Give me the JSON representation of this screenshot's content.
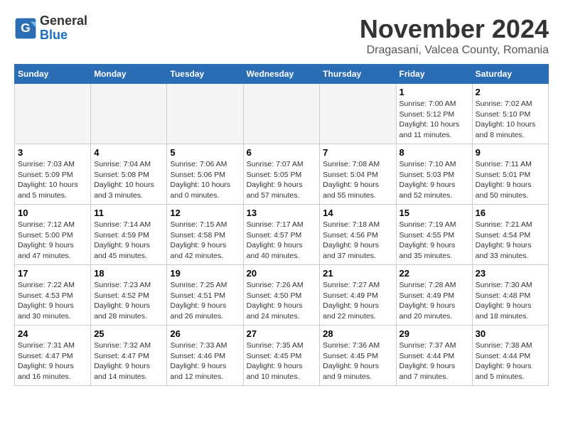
{
  "header": {
    "logo": {
      "general": "General",
      "blue": "Blue"
    },
    "title": "November 2024",
    "subtitle": "Dragasani, Valcea County, Romania"
  },
  "weekdays": [
    "Sunday",
    "Monday",
    "Tuesday",
    "Wednesday",
    "Thursday",
    "Friday",
    "Saturday"
  ],
  "weeks": [
    [
      {
        "day": "",
        "info": ""
      },
      {
        "day": "",
        "info": ""
      },
      {
        "day": "",
        "info": ""
      },
      {
        "day": "",
        "info": ""
      },
      {
        "day": "",
        "info": ""
      },
      {
        "day": "1",
        "info": "Sunrise: 7:00 AM\nSunset: 5:12 PM\nDaylight: 10 hours and 11 minutes."
      },
      {
        "day": "2",
        "info": "Sunrise: 7:02 AM\nSunset: 5:10 PM\nDaylight: 10 hours and 8 minutes."
      }
    ],
    [
      {
        "day": "3",
        "info": "Sunrise: 7:03 AM\nSunset: 5:09 PM\nDaylight: 10 hours and 5 minutes."
      },
      {
        "day": "4",
        "info": "Sunrise: 7:04 AM\nSunset: 5:08 PM\nDaylight: 10 hours and 3 minutes."
      },
      {
        "day": "5",
        "info": "Sunrise: 7:06 AM\nSunset: 5:06 PM\nDaylight: 10 hours and 0 minutes."
      },
      {
        "day": "6",
        "info": "Sunrise: 7:07 AM\nSunset: 5:05 PM\nDaylight: 9 hours and 57 minutes."
      },
      {
        "day": "7",
        "info": "Sunrise: 7:08 AM\nSunset: 5:04 PM\nDaylight: 9 hours and 55 minutes."
      },
      {
        "day": "8",
        "info": "Sunrise: 7:10 AM\nSunset: 5:03 PM\nDaylight: 9 hours and 52 minutes."
      },
      {
        "day": "9",
        "info": "Sunrise: 7:11 AM\nSunset: 5:01 PM\nDaylight: 9 hours and 50 minutes."
      }
    ],
    [
      {
        "day": "10",
        "info": "Sunrise: 7:12 AM\nSunset: 5:00 PM\nDaylight: 9 hours and 47 minutes."
      },
      {
        "day": "11",
        "info": "Sunrise: 7:14 AM\nSunset: 4:59 PM\nDaylight: 9 hours and 45 minutes."
      },
      {
        "day": "12",
        "info": "Sunrise: 7:15 AM\nSunset: 4:58 PM\nDaylight: 9 hours and 42 minutes."
      },
      {
        "day": "13",
        "info": "Sunrise: 7:17 AM\nSunset: 4:57 PM\nDaylight: 9 hours and 40 minutes."
      },
      {
        "day": "14",
        "info": "Sunrise: 7:18 AM\nSunset: 4:56 PM\nDaylight: 9 hours and 37 minutes."
      },
      {
        "day": "15",
        "info": "Sunrise: 7:19 AM\nSunset: 4:55 PM\nDaylight: 9 hours and 35 minutes."
      },
      {
        "day": "16",
        "info": "Sunrise: 7:21 AM\nSunset: 4:54 PM\nDaylight: 9 hours and 33 minutes."
      }
    ],
    [
      {
        "day": "17",
        "info": "Sunrise: 7:22 AM\nSunset: 4:53 PM\nDaylight: 9 hours and 30 minutes."
      },
      {
        "day": "18",
        "info": "Sunrise: 7:23 AM\nSunset: 4:52 PM\nDaylight: 9 hours and 28 minutes."
      },
      {
        "day": "19",
        "info": "Sunrise: 7:25 AM\nSunset: 4:51 PM\nDaylight: 9 hours and 26 minutes."
      },
      {
        "day": "20",
        "info": "Sunrise: 7:26 AM\nSunset: 4:50 PM\nDaylight: 9 hours and 24 minutes."
      },
      {
        "day": "21",
        "info": "Sunrise: 7:27 AM\nSunset: 4:49 PM\nDaylight: 9 hours and 22 minutes."
      },
      {
        "day": "22",
        "info": "Sunrise: 7:28 AM\nSunset: 4:49 PM\nDaylight: 9 hours and 20 minutes."
      },
      {
        "day": "23",
        "info": "Sunrise: 7:30 AM\nSunset: 4:48 PM\nDaylight: 9 hours and 18 minutes."
      }
    ],
    [
      {
        "day": "24",
        "info": "Sunrise: 7:31 AM\nSunset: 4:47 PM\nDaylight: 9 hours and 16 minutes."
      },
      {
        "day": "25",
        "info": "Sunrise: 7:32 AM\nSunset: 4:47 PM\nDaylight: 9 hours and 14 minutes."
      },
      {
        "day": "26",
        "info": "Sunrise: 7:33 AM\nSunset: 4:46 PM\nDaylight: 9 hours and 12 minutes."
      },
      {
        "day": "27",
        "info": "Sunrise: 7:35 AM\nSunset: 4:45 PM\nDaylight: 9 hours and 10 minutes."
      },
      {
        "day": "28",
        "info": "Sunrise: 7:36 AM\nSunset: 4:45 PM\nDaylight: 9 hours and 9 minutes."
      },
      {
        "day": "29",
        "info": "Sunrise: 7:37 AM\nSunset: 4:44 PM\nDaylight: 9 hours and 7 minutes."
      },
      {
        "day": "30",
        "info": "Sunrise: 7:38 AM\nSunset: 4:44 PM\nDaylight: 9 hours and 5 minutes."
      }
    ]
  ]
}
